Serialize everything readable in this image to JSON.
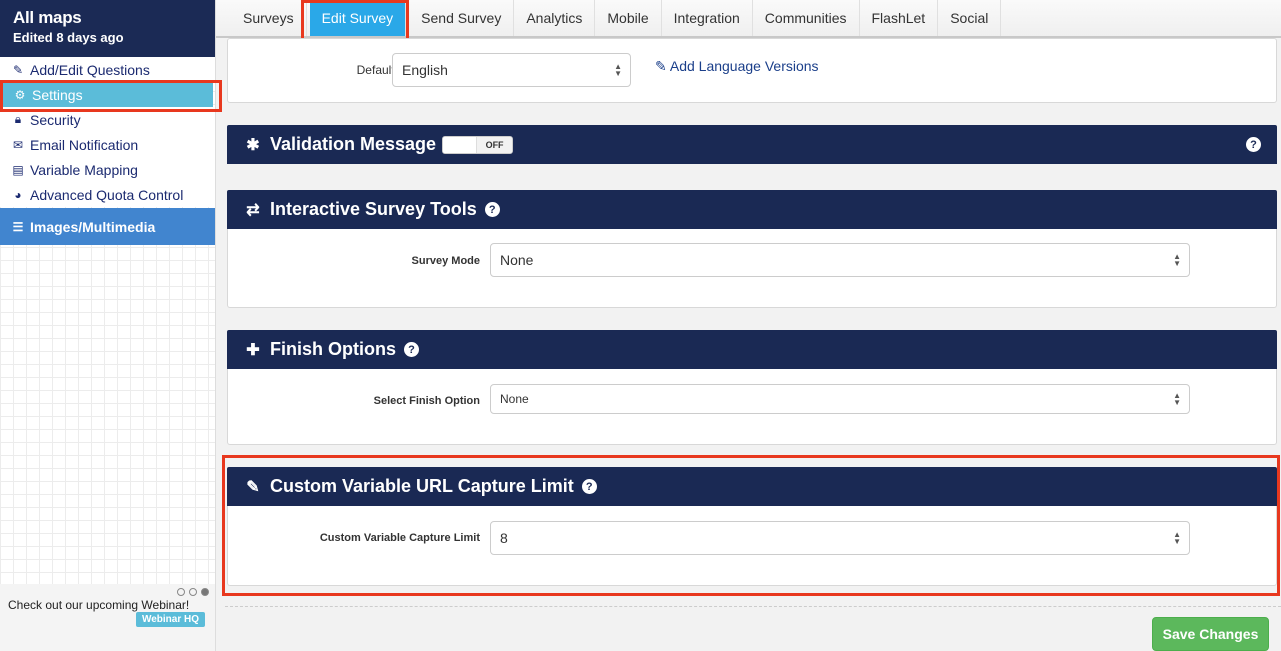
{
  "sidebar": {
    "title": "All maps",
    "subtitle": "Edited 8 days ago",
    "items": [
      {
        "label": "Add/Edit Questions",
        "icon": "edit-icon"
      },
      {
        "label": "Settings",
        "icon": "gears-icon"
      },
      {
        "label": "Security",
        "icon": "lock-icon"
      },
      {
        "label": "Email Notification",
        "icon": "envelope-icon"
      },
      {
        "label": "Variable Mapping",
        "icon": "list-alt-icon"
      },
      {
        "label": "Advanced Quota Control",
        "icon": "pie-chart-icon"
      }
    ],
    "section": {
      "label": "Images/Multimedia",
      "icon": "list-icon"
    },
    "webinar": {
      "text": "Check out our upcoming Webinar!",
      "button": "Webinar HQ"
    }
  },
  "tabs": [
    "Surveys",
    "Edit Survey",
    "Send Survey",
    "Analytics",
    "Mobile",
    "Integration",
    "Communities",
    "FlashLet",
    "Social"
  ],
  "active_tab": "Edit Survey",
  "language": {
    "label": "Default:",
    "value": "English",
    "link": "Add Language Versions"
  },
  "panels": {
    "validation": {
      "title": "Validation Message",
      "toggle": "OFF"
    },
    "interactive": {
      "title": "Interactive Survey Tools",
      "field_label": "Survey Mode",
      "value": "None"
    },
    "finish": {
      "title": "Finish Options",
      "field_label": "Select Finish Option",
      "value": "None"
    },
    "custom": {
      "title": "Custom Variable URL Capture Limit",
      "field_label": "Custom Variable Capture Limit",
      "value": "8"
    }
  },
  "save_label": "Save Changes"
}
